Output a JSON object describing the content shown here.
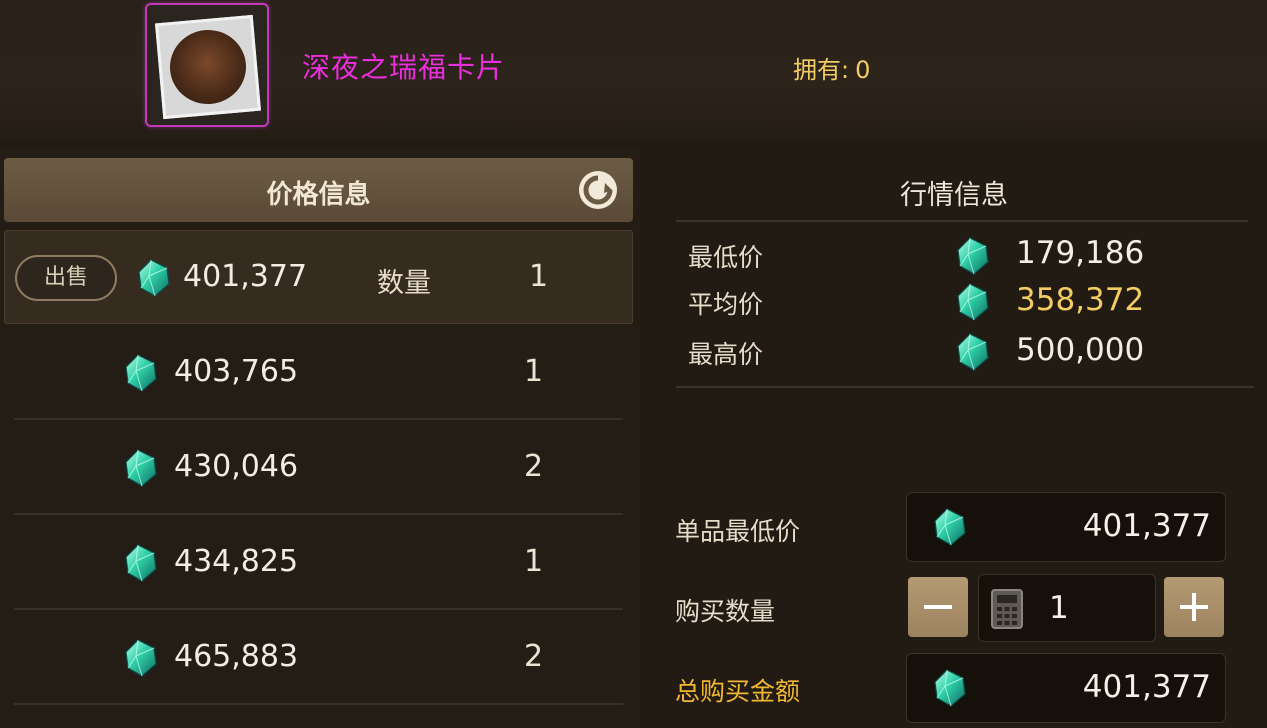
{
  "item": {
    "name": "深夜之瑞福卡片",
    "owned_label": "拥有:",
    "owned_value": "0"
  },
  "price_panel": {
    "title": "价格信息",
    "sell_label": "出售",
    "qty_label": "数量",
    "rows": [
      {
        "price": "401,377",
        "qty": "1"
      },
      {
        "price": "403,765",
        "qty": "1"
      },
      {
        "price": "430,046",
        "qty": "2"
      },
      {
        "price": "434,825",
        "qty": "1"
      },
      {
        "price": "465,883",
        "qty": "2"
      }
    ]
  },
  "market_panel": {
    "title": "行情信息",
    "min_label": "最低价",
    "min_value": "179,186",
    "avg_label": "平均价",
    "avg_value": "358,372",
    "max_label": "最高价",
    "max_value": "500,000"
  },
  "purchase": {
    "unit_min_label": "单品最低价",
    "unit_min_value": "401,377",
    "qty_label": "购买数量",
    "qty_value": "1",
    "total_label": "总购买金额",
    "total_value": "401,377"
  },
  "colors": {
    "item_name": "#ec2fdc",
    "gold": "#f3cc62",
    "gem": "#2fd0a8"
  },
  "icons": {
    "currency": "gem-icon",
    "refresh": "refresh-icon",
    "calculator": "calculator-icon",
    "minus": "minus-icon",
    "plus": "plus-icon"
  }
}
